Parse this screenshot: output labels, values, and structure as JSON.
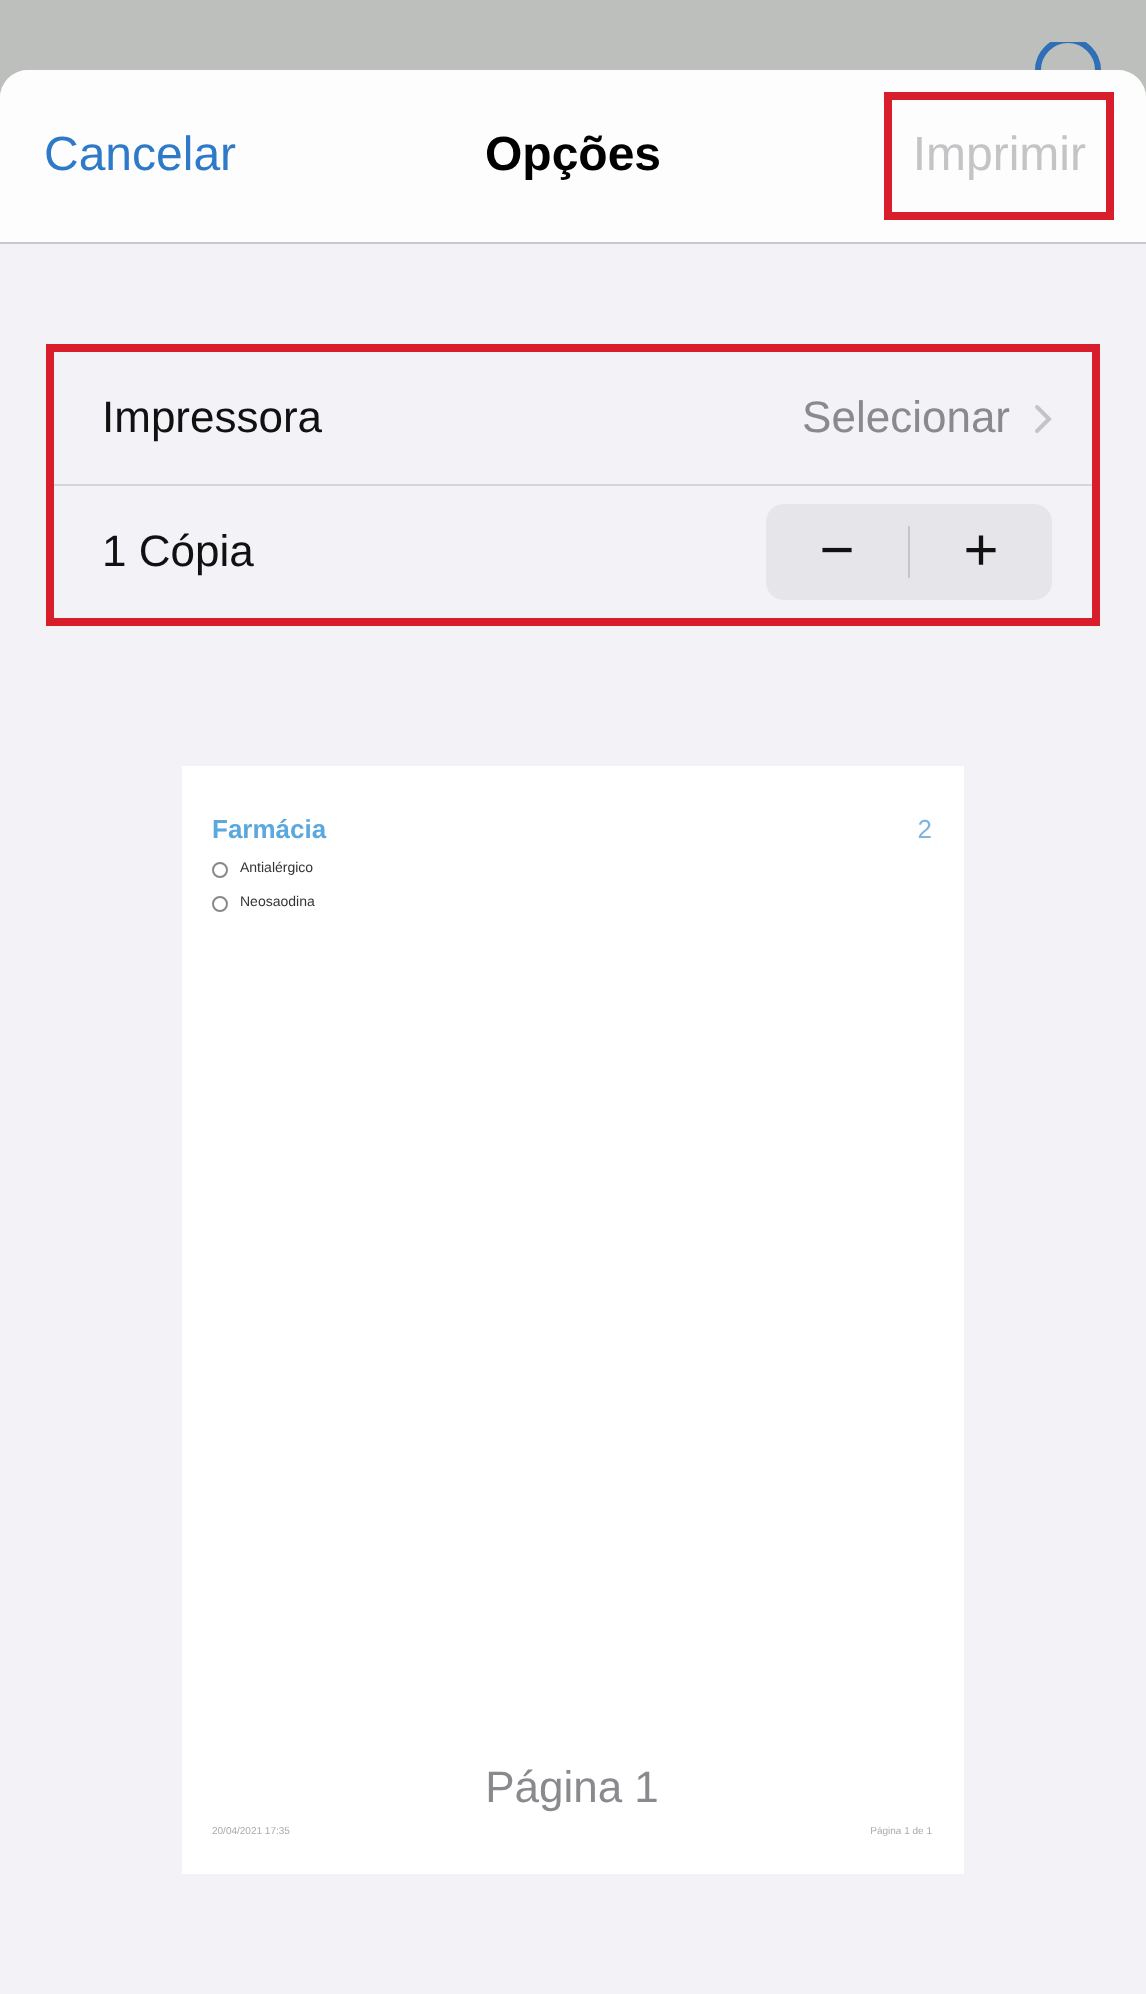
{
  "header": {
    "cancel": "Cancelar",
    "title": "Opções",
    "print": {
      "label": "Imprimir",
      "disabled": true,
      "highlighted": true
    }
  },
  "settings": {
    "highlighted": true,
    "rows": [
      {
        "kind": "link",
        "label": "Impressora",
        "value": "Selecionar"
      },
      {
        "kind": "stepper",
        "label": "1 Cópia",
        "minus": "−",
        "plus": "+"
      }
    ]
  },
  "preview": {
    "list_title": "Farmácia",
    "count": "2",
    "items": [
      {
        "text": "Antialérgico",
        "checked": false
      },
      {
        "text": "Neosaodina",
        "checked": false
      }
    ],
    "page_label": "Página 1",
    "footer_left": "20/04/2021 17:35",
    "footer_right": "Página 1 de 1"
  }
}
